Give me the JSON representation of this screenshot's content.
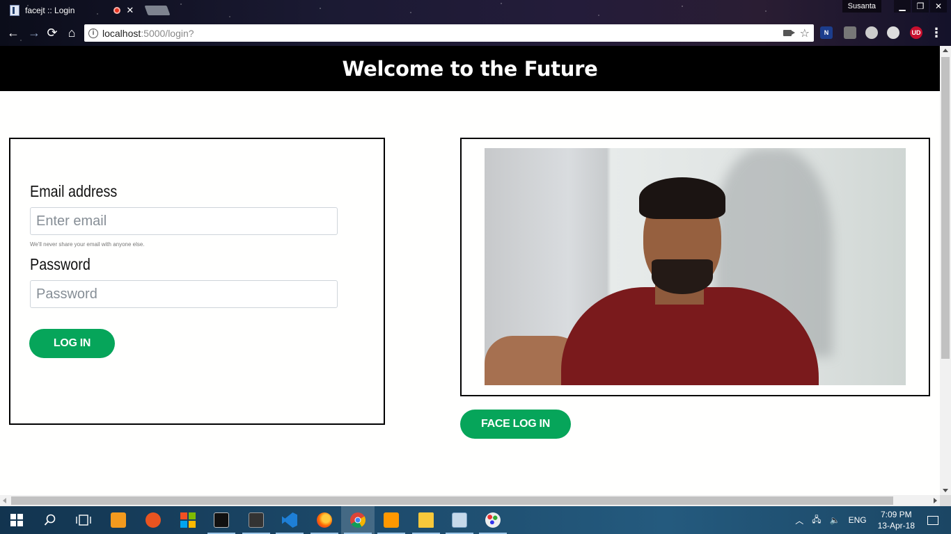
{
  "browser": {
    "tab_title": "facejt :: Login",
    "tab_close": "✕",
    "profile_name": "Susanta",
    "url_host": "localhost",
    "url_path": ":5000/login?",
    "info_icon": "i",
    "extensions": [
      "N",
      "UD"
    ]
  },
  "page": {
    "banner_title": "Welcome to the Future",
    "form": {
      "email_label": "Email address",
      "email_placeholder": "Enter email",
      "email_value": "",
      "email_help": "We'll never share your email with anyone else.",
      "password_label": "Password",
      "password_placeholder": "Password",
      "password_value": "",
      "login_button": "LOG IN"
    },
    "face_login_button": "FACE LOG IN"
  },
  "taskbar": {
    "language": "ENG",
    "time": "7:09 PM",
    "date": "13-Apr-18"
  },
  "colors": {
    "banner_bg": "#000000",
    "accent_green": "#06a55a",
    "taskbar_bg": "#1d4b6c"
  }
}
